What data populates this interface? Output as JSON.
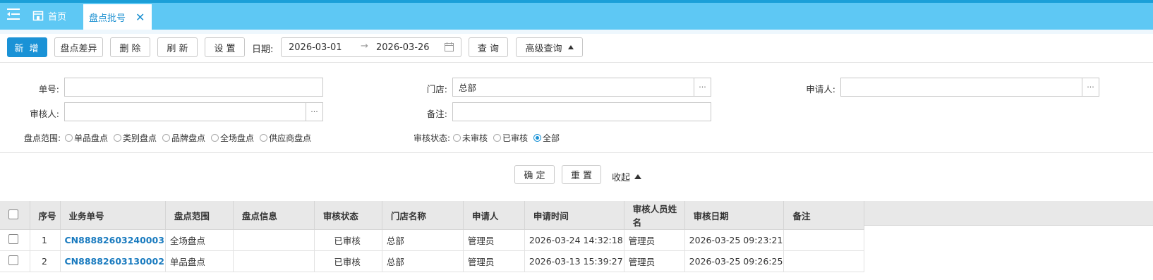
{
  "tabs": {
    "home_label": "首页",
    "active_label": "盘点批号",
    "close_glyph": "✕"
  },
  "toolbar": {
    "new_label": "新 增",
    "diff_label": "盘点差异",
    "delete_label": "删 除",
    "refresh_label": "刷 新",
    "settings_label": "设 置",
    "date_label": "日期:",
    "date_from": "2026-03-01",
    "date_arrow": "→",
    "date_to": "2026-03-26",
    "query_label": "查 询",
    "advanced_label": "高级查询"
  },
  "form": {
    "order_no_label": "单号:",
    "order_no_value": "",
    "store_label": "门店:",
    "store_value": "总部",
    "applicant_label": "申请人:",
    "applicant_value": "",
    "reviewer_label": "审核人:",
    "reviewer_value": "",
    "remark_label": "备注:",
    "remark_value": "",
    "dots": "···",
    "scope_label": "盘点范围:",
    "scope_options": [
      "单品盘点",
      "类别盘点",
      "品牌盘点",
      "全场盘点",
      "供应商盘点"
    ],
    "status_label": "审核状态:",
    "status_options": [
      "未审核",
      "已审核",
      "全部"
    ],
    "status_selected": "全部",
    "confirm_label": "确 定",
    "reset_label": "重 置",
    "collapse_label": "收起"
  },
  "table": {
    "headers": [
      "序号",
      "业务单号",
      "盘点范围",
      "盘点信息",
      "审核状态",
      "门店名称",
      "申请人",
      "申请时间",
      "审核人员姓名",
      "审核日期",
      "备注"
    ],
    "rows": [
      [
        "1",
        "CN88882603240003",
        "全场盘点",
        "",
        "已审核",
        "总部",
        "管理员",
        "2026-03-24 14:32:18",
        "管理员",
        "2026-03-25 09:23:21",
        ""
      ],
      [
        "2",
        "CN88882603130002",
        "单品盘点",
        "",
        "已审核",
        "总部",
        "管理员",
        "2026-03-13 15:39:27",
        "管理员",
        "2026-03-25 09:26:25",
        ""
      ]
    ]
  },
  "colors": {
    "tabbar": "#5ec8f4",
    "primary": "#1a92d6",
    "link": "#1a7bbf"
  }
}
